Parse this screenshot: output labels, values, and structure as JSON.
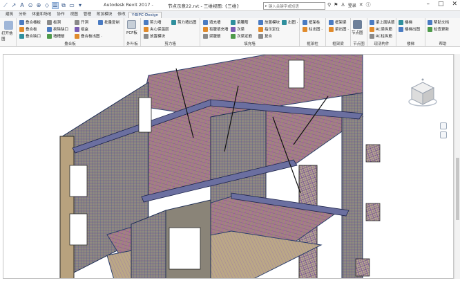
{
  "app": {
    "title": "Autodesk Revit 2017 -",
    "file_title": "节点示意22.rvt - 三维视图: {三维}",
    "search_placeholder": "键入关键字或短语",
    "user": "登录"
  },
  "tabs": [
    "建筑",
    "分析",
    "体量和场地",
    "协作",
    "视图",
    "管理",
    "附加模块",
    "修改",
    "Y-BIPC-Design"
  ],
  "active_tab": 8,
  "ribbon": {
    "panels": [
      {
        "title": "",
        "items": [
          "打开他图"
        ]
      },
      {
        "title": "叠合板",
        "items": [
          "叠合楼板",
          "叠合板",
          "叠合缺口",
          "板洞",
          "拆除缺口",
          "墙槽筋",
          "开洞",
          "组盒",
          "叠合板出图 ·",
          "批量复制"
        ]
      },
      {
        "title": "外叶板",
        "items": [
          "PCF板"
        ]
      },
      {
        "title": "剪力墙",
        "items": [
          "剪力墙",
          "夹心保温层",
          "放置模块",
          "剪力墙出图"
        ]
      },
      {
        "title": "填充墙",
        "items": [
          "填充墙",
          "有腹填充墙",
          "梁腹筋",
          "梁腰筋",
          "次梁",
          "次梁定筋",
          "放置模块",
          "指示定位",
          "复合",
          "出图 ·"
        ]
      },
      {
        "title": "框架柱",
        "items": [
          "框架柱",
          "柱出图 ·"
        ]
      },
      {
        "title": "框架梁",
        "items": [
          "框架梁",
          "梁出图 ·"
        ]
      },
      {
        "title": "节点图",
        "items": [
          "节点图"
        ]
      },
      {
        "title": "现浇构件",
        "items": [
          "梁上面纵筋",
          "RC梁纵筋",
          "RC柱纵筋"
        ]
      },
      {
        "title": "楼梯",
        "items": [
          "楼梯",
          "楼梯出图"
        ]
      },
      {
        "title": "帮助",
        "items": [
          "帮助文档",
          "检查更新"
        ]
      }
    ]
  }
}
